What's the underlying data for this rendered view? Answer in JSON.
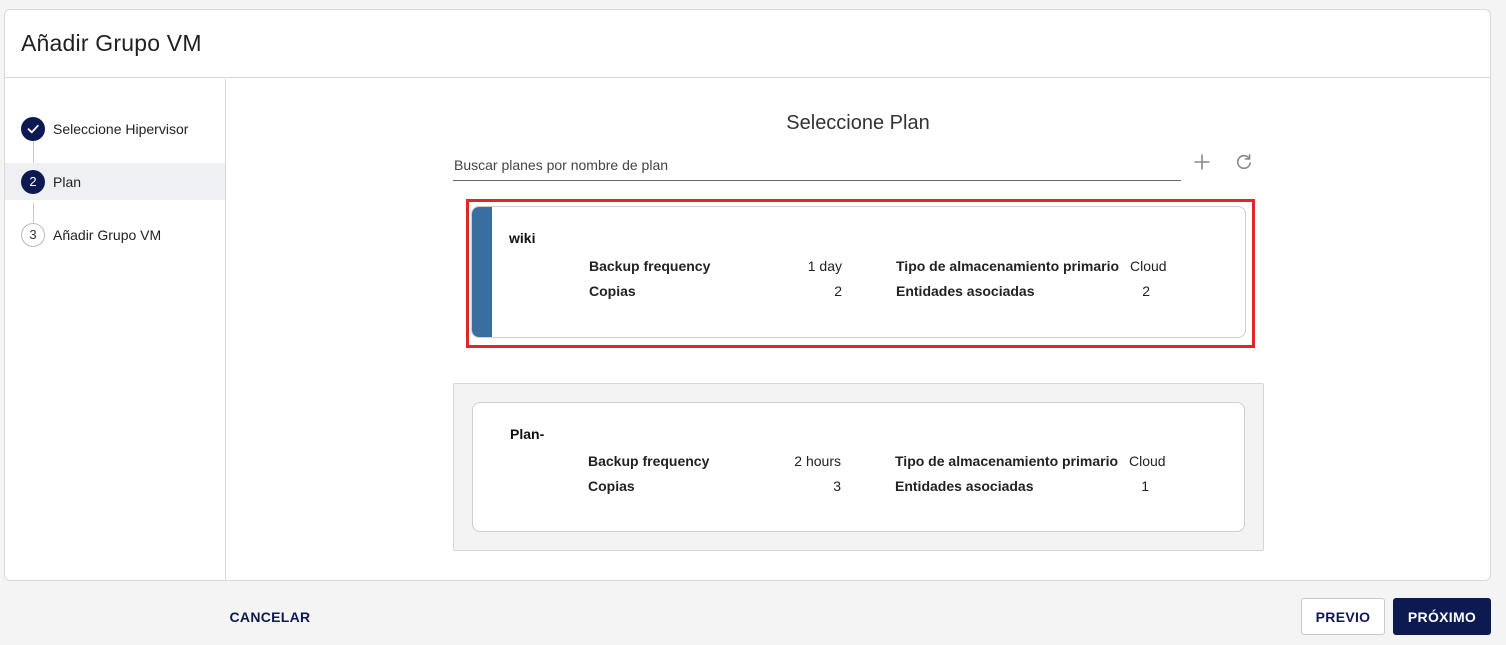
{
  "dialog": {
    "title": "Añadir Grupo VM"
  },
  "steps": [
    {
      "number": "1",
      "label": "Seleccione Hipervisor",
      "state": "done"
    },
    {
      "number": "2",
      "label": "Plan",
      "state": "current"
    },
    {
      "number": "3",
      "label": "Añadir Grupo VM",
      "state": "pending"
    }
  ],
  "main": {
    "title": "Seleccione Plan",
    "search": {
      "placeholder": "Buscar planes por nombre de plan",
      "value": ""
    }
  },
  "plans": [
    {
      "name": "wiki",
      "selected": true,
      "backup_frequency_label": "Backup frequency",
      "backup_frequency": "1 day",
      "copies_label": "Copias",
      "copies": "2",
      "storage_label": "Tipo de almacenamiento primario",
      "storage": "Cloud",
      "entities_label": "Entidades asociadas",
      "entities": "2"
    },
    {
      "name": "Plan-",
      "selected": false,
      "backup_frequency_label": "Backup frequency",
      "backup_frequency": "2 hours",
      "copies_label": "Copias",
      "copies": "3",
      "storage_label": "Tipo de almacenamiento primario",
      "storage": "Cloud",
      "entities_label": "Entidades asociadas",
      "entities": "1"
    }
  ],
  "footer": {
    "cancel_label": "CANCELAR",
    "prev_label": "PREVIO",
    "next_label": "PRÓXIMO"
  },
  "colors": {
    "primary": "#0d1a52",
    "plan_accent": "#3a6e9e",
    "selection_highlight": "#e0262b"
  },
  "icons": {
    "add": "plus-icon",
    "refresh": "refresh-icon",
    "step_done": "check-icon"
  }
}
